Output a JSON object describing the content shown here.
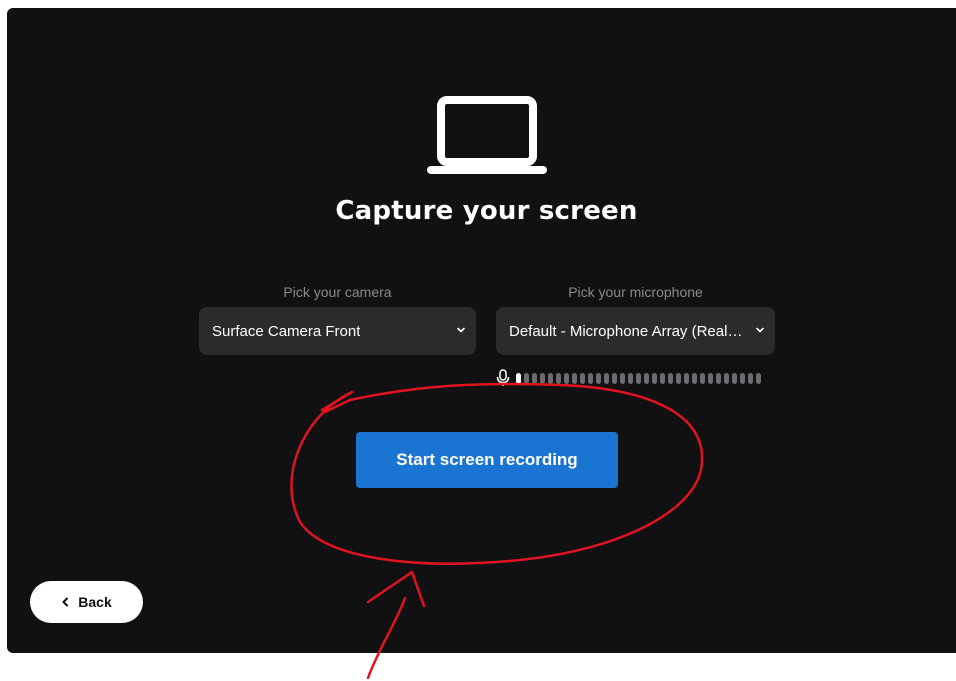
{
  "main": {
    "title": "Capture your screen",
    "camera": {
      "label": "Pick your camera",
      "selected": "Surface Camera Front"
    },
    "microphone": {
      "label": "Pick your microphone",
      "selected": "Default - Microphone Array (Realtek(R) Audio)",
      "level": 0.04
    },
    "start_button": "Start screen recording",
    "back_button": "Back"
  },
  "icons": [
    "laptop-icon",
    "chevron-down-icon",
    "microphone-icon",
    "chevron-left-icon"
  ],
  "colors": {
    "panel_bg": "#111113",
    "select_bg": "#2b2b2e",
    "accent": "#1a75d2",
    "annotation": "#e0141e"
  }
}
